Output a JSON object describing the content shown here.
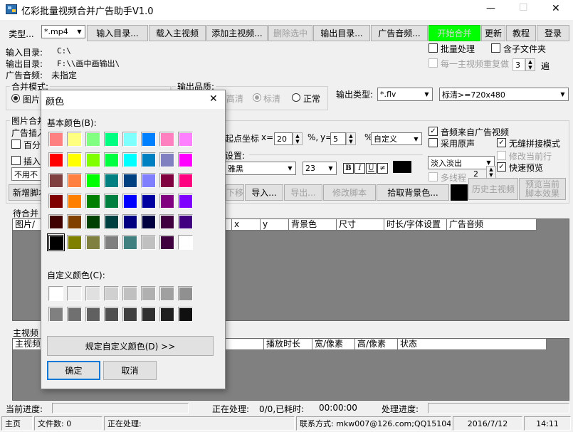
{
  "window": {
    "title": "亿彩批量视频合并广告助手V1.0",
    "controls": {
      "minimize": "—",
      "maximize": "☐",
      "close": "✕"
    }
  },
  "toolbar": {
    "type_label": "类型...",
    "type_value": "*.mp4",
    "input_dir": "输入目录...",
    "load_main": "载入主视频",
    "add_main": "添加主视频...",
    "delete_selected": "删除选中",
    "output_dir": "输出目录...",
    "ad_audio": "广告音频...",
    "start_merge": "开始合并",
    "update": "更新",
    "tutorial": "教程",
    "login": "登录"
  },
  "info": {
    "input_dir_label": "输入目录:",
    "input_dir_value": "C:\\",
    "output_dir_label": "输出目录:",
    "output_dir_value": "F:\\\\画中画输出\\",
    "ad_audio_label": "广告音频:",
    "ad_audio_value": "未指定"
  },
  "options": {
    "batch": "批量处理",
    "subfolders": "含子文件夹",
    "repeat_each": "每一主视频重复做",
    "repeat_count": "3",
    "repeat_unit": "遍"
  },
  "merge_mode": {
    "title": "合并模式:",
    "option_image": "图片"
  },
  "quality": {
    "title": "输出品质:",
    "high": "高清",
    "standard": "标清",
    "normal": "正常"
  },
  "output_type": {
    "label": "输出类型:",
    "value": "*.flv",
    "res_value": "标清>=720x480"
  },
  "image_section": {
    "title": "图片合并",
    "ad_insert": "广告插入",
    "percent": "百分",
    "insert": "插入",
    "no_use": "不用不",
    "new_script": "新增脚本"
  },
  "position": {
    "start_coord": "起点坐标",
    "x_label": "x=",
    "x_value": "20",
    "pct1": "%,",
    "y_label": "y=",
    "y_value": "5",
    "pct2": "%",
    "custom": "自定义",
    "settings_label": "设置:",
    "font": "雅黑",
    "font_size": "23",
    "bold": "B",
    "italic": "I",
    "underline": "U",
    "strike": "≠",
    "text_color": "#000000"
  },
  "audio_opts": {
    "from_ad": "音频来自广告视频",
    "use_original": "采用原声",
    "seamless": "无缝拼接模式",
    "modify_current": "修改当前行",
    "fast_preview": "快速预览",
    "fade": "淡入淡出",
    "multiline": "多线程",
    "thread_count": "2"
  },
  "script_buttons": {
    "move_down": "下移",
    "import": "导入...",
    "export": "导出...",
    "modify_script": "修改脚本",
    "pick_bg": "拾取背景色...",
    "bg_color": "#000000",
    "history_main": "历史主视频",
    "preview_line1": "预览当前",
    "preview_line2": "脚本效果"
  },
  "pending_grid": {
    "title": "待合并",
    "columns": [
      "图片/",
      "x",
      "y",
      "背景色",
      "尺寸",
      "时长/字体设置",
      "广告音频"
    ]
  },
  "main_grid": {
    "title": "主视频",
    "columns": [
      "主视频",
      "播放时长",
      "宽/像素",
      "高/像素",
      "状态"
    ]
  },
  "progress": {
    "current_label": "当前进度:",
    "processing_label": "正在处理:",
    "processing_value": "0/0,已耗时:",
    "elapsed": "00:00:00",
    "handle_label": "处理进度:"
  },
  "statusbar": {
    "home": "主页",
    "file_count": "文件数: 0",
    "processing": "正在处理:",
    "contact": "联系方式: mkw007@126.com;QQ15104946",
    "date": "2016/7/12",
    "time": "14:11"
  },
  "color_dialog": {
    "title": "颜色",
    "basic_label": "基本颜色(B):",
    "custom_label": "自定义颜色(C):",
    "define_button": "规定自定义颜色(D) >>",
    "ok": "确定",
    "cancel": "取消",
    "close": "✕",
    "basic_colors": [
      "#FF8080",
      "#FFFF80",
      "#80FF80",
      "#00FF80",
      "#80FFFF",
      "#0080FF",
      "#FF80C0",
      "#FF80FF",
      "#FF0000",
      "#FFFF00",
      "#80FF00",
      "#00FF40",
      "#00FFFF",
      "#0080C0",
      "#8080C0",
      "#FF00FF",
      "#804040",
      "#FF8040",
      "#00FF00",
      "#008080",
      "#004080",
      "#8080FF",
      "#800040",
      "#FF0080",
      "#800000",
      "#FF8000",
      "#008000",
      "#008040",
      "#0000FF",
      "#0000A0",
      "#800080",
      "#8000FF",
      "#400000",
      "#804000",
      "#004000",
      "#004040",
      "#000080",
      "#000040",
      "#400040",
      "#400080",
      "#000000",
      "#808000",
      "#808040",
      "#808080",
      "#408080",
      "#C0C0C0",
      "#400040",
      "#FFFFFF"
    ],
    "selected_index": 40,
    "custom_colors": [
      "#FFFFFF",
      "#F0F0F0",
      "#E0E0E0",
      "#D0D0D0",
      "#C0C0C0",
      "#B0B0B0",
      "#A0A0A0",
      "#909090",
      "#808080",
      "#707070",
      "#606060",
      "#505050",
      "#404040",
      "#303030",
      "#202020",
      "#101010"
    ]
  }
}
